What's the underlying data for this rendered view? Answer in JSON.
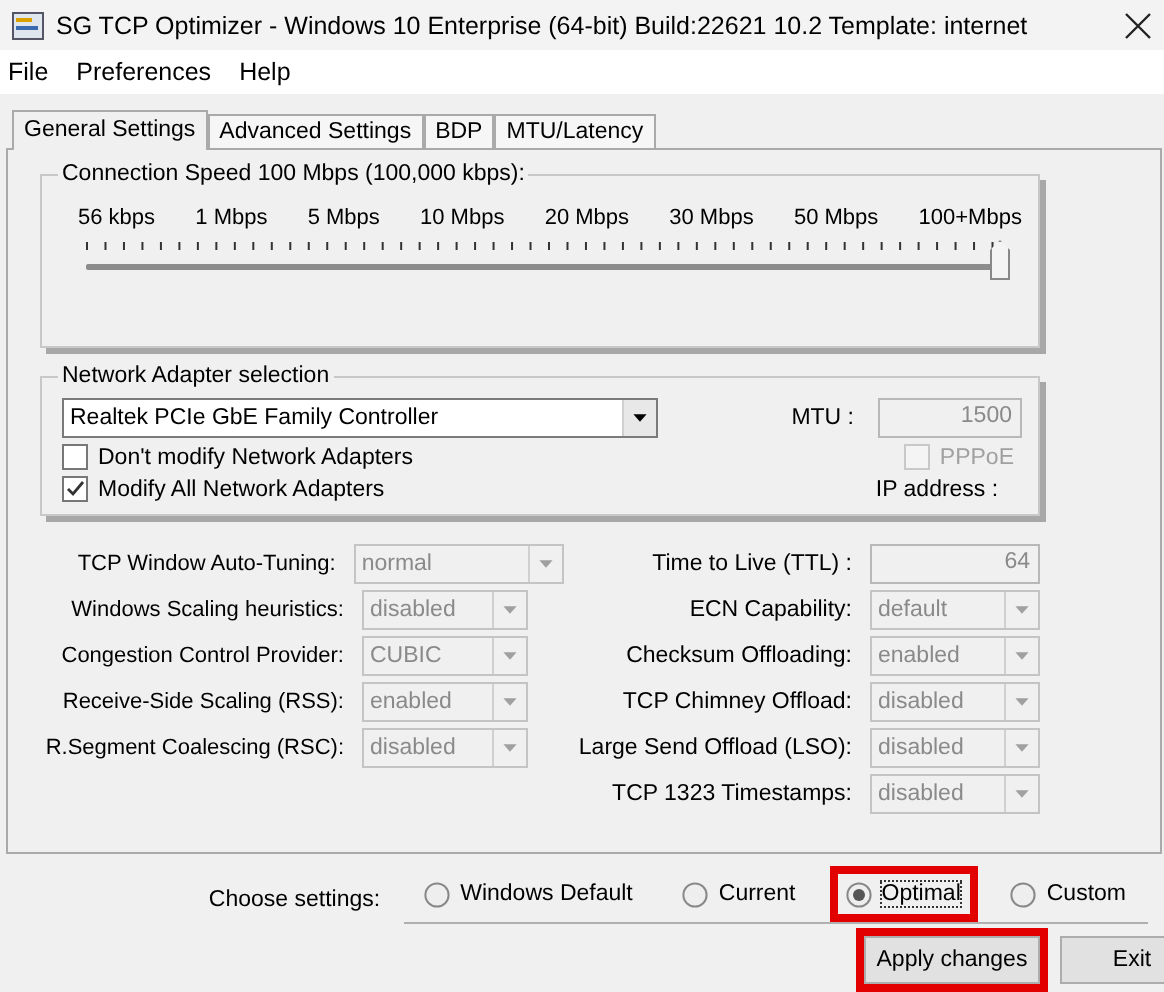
{
  "window": {
    "title": "SG TCP Optimizer - Windows 10 Enterprise (64-bit) Build:22621 10.2  Template: internet"
  },
  "menu": [
    "File",
    "Preferences",
    "Help"
  ],
  "tabs": [
    {
      "label": "General Settings",
      "selected": true
    },
    {
      "label": "Advanced Settings",
      "selected": false
    },
    {
      "label": "BDP",
      "selected": false
    },
    {
      "label": "MTU/Latency",
      "selected": false
    }
  ],
  "connection_speed": {
    "legend": "Connection Speed  100 Mbps (100,000 kbps):",
    "scale": [
      "56 kbps",
      "1 Mbps",
      "5 Mbps",
      "10 Mbps",
      "20 Mbps",
      "30 Mbps",
      "50 Mbps",
      "100+Mbps"
    ],
    "level": 1
  },
  "network_adapter": {
    "legend": "Network Adapter selection",
    "adapter": "Realtek PCIe GbE Family Controller",
    "mtu_label": "MTU :",
    "mtu": "1500",
    "options": [
      {
        "label": "Don't modify Network Adapters",
        "checked": false
      },
      {
        "label": "Modify All Network Adapters",
        "checked": true
      }
    ],
    "pppoe": {
      "label": "PPPoE",
      "checked": false,
      "disabled": true
    },
    "ip_label": "IP address :"
  },
  "settings_left": [
    {
      "label": "TCP Window Auto-Tuning:",
      "value": "normal",
      "wide": true
    },
    {
      "label": "Windows Scaling heuristics:",
      "value": "disabled",
      "wide": false
    },
    {
      "label": "Congestion Control Provider:",
      "value": "CUBIC",
      "wide": false
    },
    {
      "label": "Receive-Side Scaling (RSS):",
      "value": "enabled",
      "wide": false
    },
    {
      "label": "R.Segment Coalescing (RSC):",
      "value": "disabled",
      "wide": false
    }
  ],
  "settings_right": [
    {
      "label": "Time to Live (TTL) :",
      "value": "64",
      "kind": "text"
    },
    {
      "label": "ECN Capability:",
      "value": "default",
      "kind": "select"
    },
    {
      "label": "Checksum Offloading:",
      "value": "enabled",
      "kind": "select"
    },
    {
      "label": "TCP Chimney Offload:",
      "value": "disabled",
      "kind": "select"
    },
    {
      "label": "Large Send Offload (LSO):",
      "value": "disabled",
      "kind": "select"
    },
    {
      "label": "TCP 1323 Timestamps:",
      "value": "disabled",
      "kind": "select"
    }
  ],
  "choose": {
    "label": "Choose settings:",
    "options": [
      {
        "label": "Windows Default",
        "selected": false,
        "highlighted": false
      },
      {
        "label": "Current",
        "selected": false,
        "highlighted": false
      },
      {
        "label": "Optimal",
        "selected": true,
        "highlighted": true
      },
      {
        "label": "Custom",
        "selected": false,
        "highlighted": false
      }
    ]
  },
  "buttons": [
    {
      "label": "Apply changes",
      "highlighted": true
    },
    {
      "label": "Exit",
      "highlighted": false
    }
  ]
}
